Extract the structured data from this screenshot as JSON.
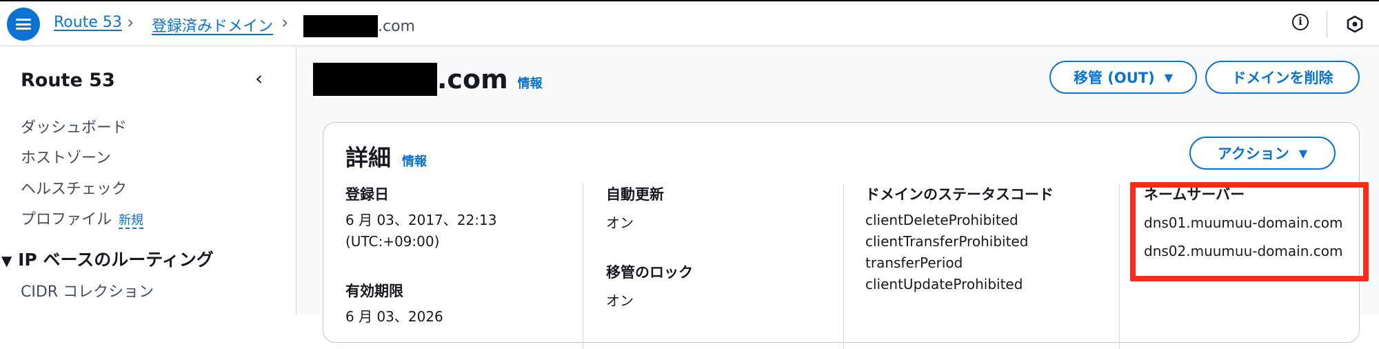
{
  "header": {
    "breadcrumbs": [
      "Route 53",
      "登録済みドメイン"
    ],
    "current_domain_suffix": ".com"
  },
  "sidebar": {
    "title": "Route 53",
    "items": [
      {
        "label": "ダッシュボード"
      },
      {
        "label": "ホストゾーン"
      },
      {
        "label": "ヘルスチェック"
      },
      {
        "label": "プロファイル",
        "badge": "新規"
      }
    ],
    "section": {
      "label": "IP ベースのルーティング",
      "items": [
        "CIDR コレクション"
      ]
    }
  },
  "main": {
    "title_suffix": ".com",
    "info_label": "情報",
    "buttons": {
      "transfer_out": "移管 (OUT)",
      "delete_domain": "ドメインを削除"
    },
    "details": {
      "title": "詳細",
      "info_label": "情報",
      "action_button": "アクション",
      "registration_date_label": "登録日",
      "registration_date_value": "6 月 03、2017、22:13",
      "registration_tz": "(UTC:+09:00)",
      "expiration_label": "有効期限",
      "expiration_value": "6 月 03、2026",
      "auto_renew_label": "自動更新",
      "auto_renew_value": "オン",
      "transfer_lock_label": "移管のロック",
      "transfer_lock_value": "オン",
      "status_codes_label": "ドメインのステータスコード",
      "status_codes": [
        "clientDeleteProhibited",
        "clientTransferProhibited",
        "transferPeriod",
        "clientUpdateProhibited"
      ],
      "nameservers_label": "ネームサーバー",
      "nameservers": [
        "dns01.muumuu-domain.com",
        "dns02.muumuu-domain.com"
      ]
    }
  },
  "colors": {
    "accent": "#0972d3",
    "highlight": "#ff2a1a"
  },
  "icons": [
    "menu-icon",
    "chevron-right-icon",
    "info-icon",
    "hexagon-icon",
    "chevron-left-icon",
    "caret-down-icon"
  ]
}
